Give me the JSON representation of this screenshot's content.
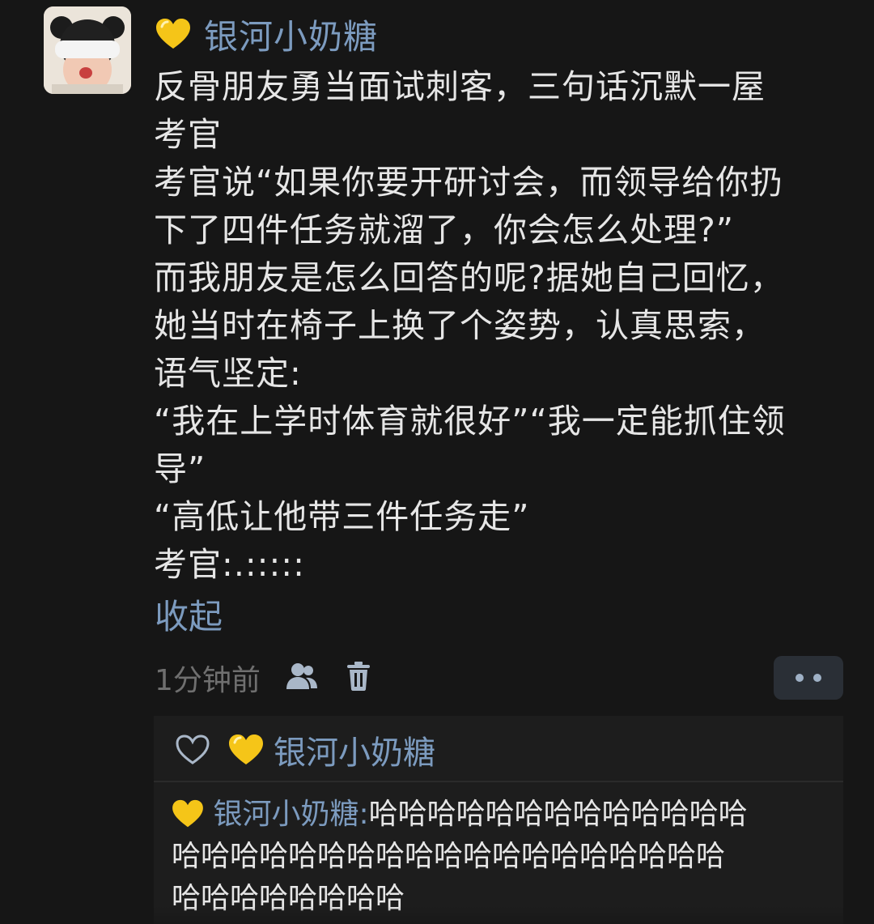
{
  "comment": {
    "author_emoji": "yellow-heart-emoji",
    "author_name": "银河小奶糖",
    "body_lines": [
      "反骨朋友勇当面试刺客，三句话沉默一屋",
      "考官",
      "考官说“如果你要开研讨会，而领导给你扔",
      "下了四件任务就溜了，你会怎么处理?”",
      "而我朋友是怎么回答的呢?据她自己回忆，",
      "她当时在椅子上换了个姿势，认真思索，",
      "语气坚定:",
      "“我在上学时体育就很好”“我一定能抓住领",
      "导”",
      "“高低让他带三件任务走”",
      "考官:.:::::"
    ],
    "collapse_label": "收起",
    "time": "1分钟前",
    "icons": [
      "user-icon",
      "trash-icon",
      "more-icon"
    ]
  },
  "reply_panel": {
    "like_icon": "heart-outline-icon",
    "liker_name": "银河小奶糖",
    "reply_author": "银河小奶糖:",
    "reply_lines": [
      "哈哈哈哈哈哈哈哈哈哈哈哈哈",
      "哈哈哈哈哈哈哈哈哈哈哈哈哈哈哈哈哈哈哈",
      "哈哈哈哈哈哈哈哈"
    ]
  },
  "colors": {
    "background": "#161616",
    "text": "#e6e6e6",
    "link": "#7c9bbf",
    "muted": "#6f6f6f",
    "panel": "#1d1d1d",
    "heart": "#f5c518"
  }
}
